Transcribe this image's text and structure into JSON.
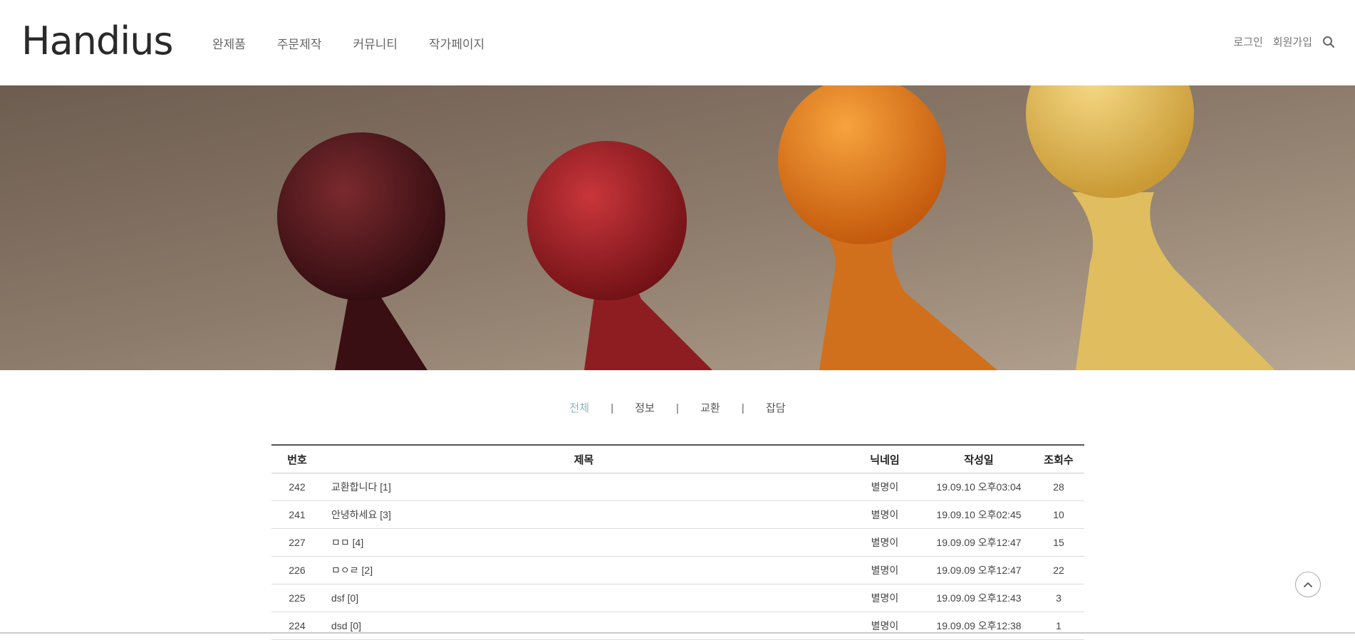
{
  "brand": {
    "logo_text": "Handius"
  },
  "nav": {
    "items": [
      {
        "label": "완제품"
      },
      {
        "label": "주문제작"
      },
      {
        "label": "커뮤니티"
      },
      {
        "label": "작가페이지"
      }
    ]
  },
  "util": {
    "login_label": "로그인",
    "signup_label": "회원가입",
    "search_icon": "search-icon"
  },
  "hero": {
    "image": "wooden-pawns-banner"
  },
  "categories": {
    "items": [
      {
        "label": "전체",
        "active": true
      },
      {
        "label": "정보"
      },
      {
        "label": "교환"
      },
      {
        "label": "잡담"
      }
    ],
    "separator": "|",
    "active_color": "#8fb4bc"
  },
  "board": {
    "headers": {
      "no": "번호",
      "title": "제목",
      "nick": "닉네임",
      "date": "작성일",
      "views": "조회수"
    },
    "rows": [
      {
        "no": "242",
        "title": "교환합니다 [1]",
        "nick": "별명이",
        "date": "19.09.10 오후03:04",
        "views": "28"
      },
      {
        "no": "241",
        "title": "안녕하세요 [3]",
        "nick": "별명이",
        "date": "19.09.10 오후02:45",
        "views": "10"
      },
      {
        "no": "227",
        "title": "ㅁㅁ [4]",
        "nick": "별명이",
        "date": "19.09.09 오후12:47",
        "views": "15"
      },
      {
        "no": "226",
        "title": "ㅁㅇㄹ [2]",
        "nick": "별명이",
        "date": "19.09.09 오후12:47",
        "views": "22"
      },
      {
        "no": "225",
        "title": "dsf [0]",
        "nick": "별명이",
        "date": "19.09.09 오후12:43",
        "views": "3"
      },
      {
        "no": "224",
        "title": "dsd [0]",
        "nick": "별명이",
        "date": "19.09.09 오후12:38",
        "views": "1"
      }
    ]
  },
  "scroll_top": {
    "icon": "chevron-up-icon"
  }
}
